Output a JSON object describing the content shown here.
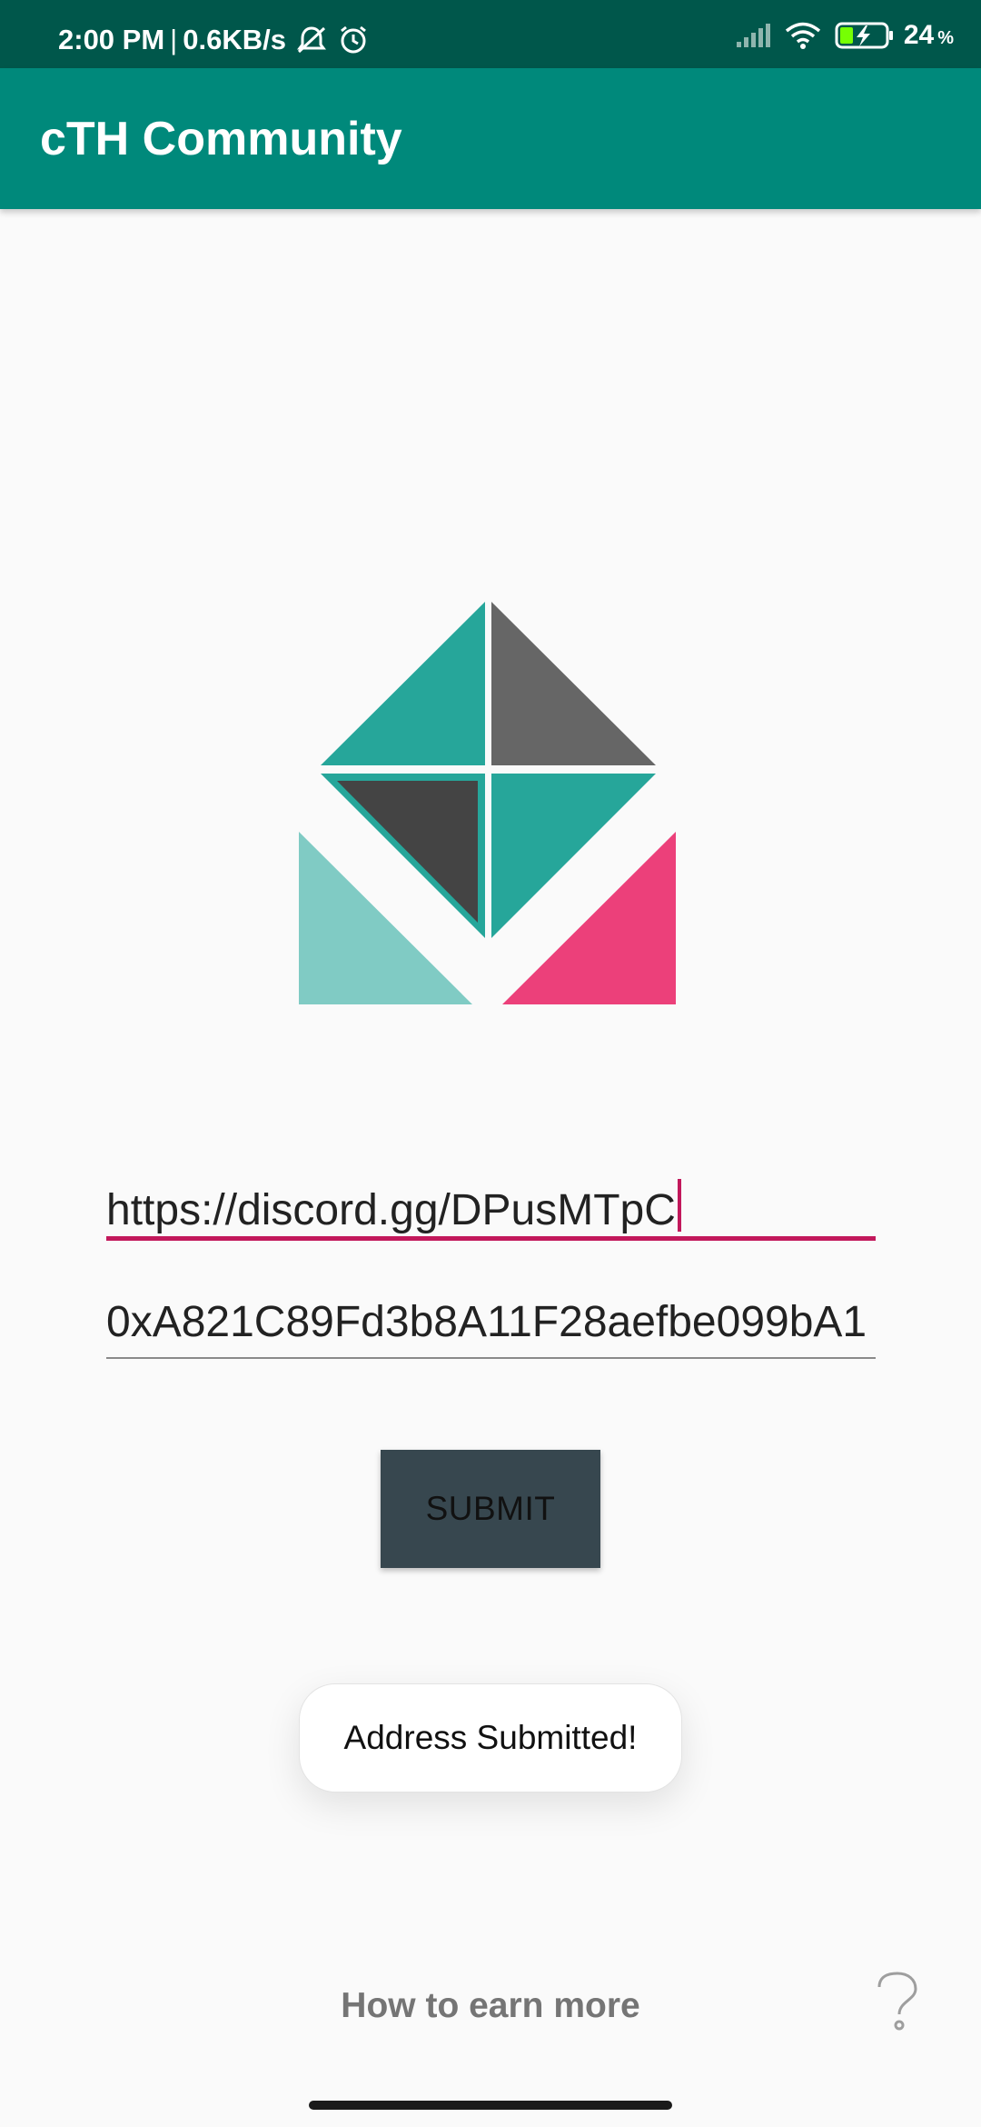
{
  "status_bar": {
    "time": "2:00 PM",
    "separator": "|",
    "network_speed": "0.6KB/s",
    "battery_level": "24",
    "battery_unit": "%",
    "icons": [
      "mute-icon",
      "alarm-icon",
      "signal-icon",
      "wifi-icon",
      "battery-charging-icon"
    ]
  },
  "app_bar": {
    "title": "cTH Community"
  },
  "form": {
    "discord_link_value": "https://discord.gg/DPusMTpC",
    "wallet_address_value": "0xA821C89Fd3b8A11F28aefbe099bA1",
    "submit_label": "SUBMIT"
  },
  "toast": {
    "message": "Address Submitted!"
  },
  "footer": {
    "how_to_earn_label": "How to earn more",
    "help_icon": "question-mark-icon"
  },
  "colors": {
    "status_bar": "#00574b",
    "app_bar": "#00897b",
    "accent": "#c2185b",
    "button": "#37474f",
    "logo_teal": "#26a69a",
    "logo_gray": "#666666",
    "logo_dark": "#444444",
    "logo_light_teal": "#80cbc4",
    "logo_pink": "#ec407a"
  }
}
